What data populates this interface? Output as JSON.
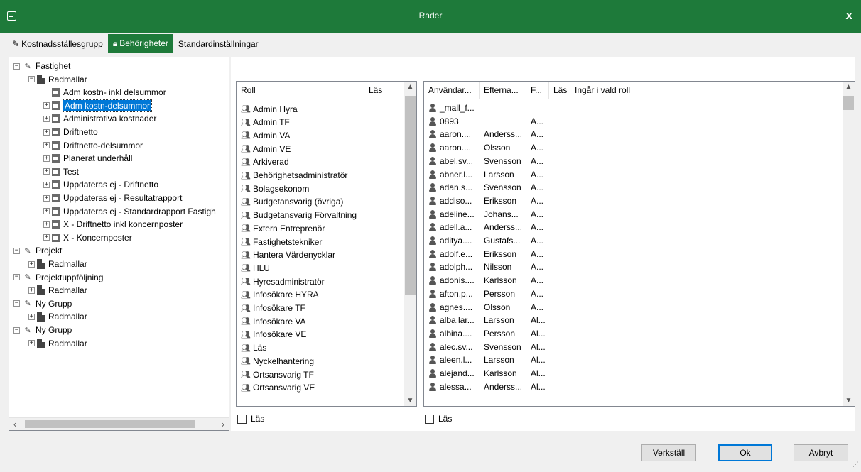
{
  "window": {
    "title": "Rader",
    "close_glyph": "x"
  },
  "tabs": [
    {
      "label": "Kostnadsställesgrupp",
      "icon": "pen-icon"
    },
    {
      "label": "Behörigheter",
      "icon": "lock-icon"
    },
    {
      "label": "Standardinställningar",
      "icon": ""
    }
  ],
  "tree": {
    "items": [
      {
        "label": "Fastighet",
        "level": 0,
        "expander": "-",
        "icon": "pen"
      },
      {
        "label": "Radmallar",
        "level": 1,
        "expander": "-",
        "icon": "folder"
      },
      {
        "label": "Adm kostn- inkl delsummor",
        "level": 2,
        "expander": "",
        "icon": "doc"
      },
      {
        "label": "Adm kostn-delsummor",
        "level": 2,
        "expander": "+",
        "icon": "doc",
        "selected": true
      },
      {
        "label": "Administrativa kostnader",
        "level": 2,
        "expander": "+",
        "icon": "doc"
      },
      {
        "label": "Driftnetto",
        "level": 2,
        "expander": "+",
        "icon": "doc"
      },
      {
        "label": "Driftnetto-delsummor",
        "level": 2,
        "expander": "+",
        "icon": "doc"
      },
      {
        "label": "Planerat underhåll",
        "level": 2,
        "expander": "+",
        "icon": "doc"
      },
      {
        "label": "Test",
        "level": 2,
        "expander": "+",
        "icon": "doc"
      },
      {
        "label": "Uppdateras ej - Driftnetto",
        "level": 2,
        "expander": "+",
        "icon": "doc"
      },
      {
        "label": "Uppdateras ej - Resultatrapport",
        "level": 2,
        "expander": "+",
        "icon": "doc"
      },
      {
        "label": "Uppdateras ej - Standardrapport Fastigh",
        "level": 2,
        "expander": "+",
        "icon": "doc"
      },
      {
        "label": "X - Driftnetto inkl koncernposter",
        "level": 2,
        "expander": "+",
        "icon": "doc"
      },
      {
        "label": "X - Koncernposter",
        "level": 2,
        "expander": "+",
        "icon": "doc"
      },
      {
        "label": "Projekt",
        "level": 0,
        "expander": "-",
        "icon": "pen"
      },
      {
        "label": "Radmallar",
        "level": 1,
        "expander": "+",
        "icon": "folder"
      },
      {
        "label": "Projektuppföljning",
        "level": 0,
        "expander": "-",
        "icon": "pen"
      },
      {
        "label": "Radmallar",
        "level": 1,
        "expander": "+",
        "icon": "folder"
      },
      {
        "label": "Ny Grupp",
        "level": 0,
        "expander": "-",
        "icon": "pen"
      },
      {
        "label": "Radmallar",
        "level": 1,
        "expander": "+",
        "icon": "folder"
      },
      {
        "label": "Ny Grupp",
        "level": 0,
        "expander": "-",
        "icon": "pen"
      },
      {
        "label": "Radmallar",
        "level": 1,
        "expander": "+",
        "icon": "folder"
      }
    ]
  },
  "roles": {
    "columns": [
      "Roll",
      "Läs"
    ],
    "rows": [
      "Admin Hyra",
      "Admin TF",
      "Admin VA",
      "Admin VE",
      "Arkiverad",
      "Behörighetsadministratör",
      "Bolagsekonom",
      "Budgetansvarig (övriga)",
      "Budgetansvarig Förvaltning",
      "Extern Entreprenör",
      "Fastighetstekniker",
      "Hantera Värdenycklar",
      "HLU",
      "Hyresadministratör",
      "Infosökare HYRA",
      "Infosökare TF",
      "Infosökare VA",
      "Infosökare VE",
      "Läs",
      "Nyckelhantering",
      "Ortsansvarig TF",
      "Ortsansvarig VE"
    ],
    "checkbox_label": "Läs"
  },
  "users": {
    "columns": [
      "Användar...",
      "Efterna...",
      "F...",
      "Läs",
      "Ingår i vald roll"
    ],
    "rows": [
      [
        "_mall_f...",
        "",
        ""
      ],
      [
        "0893",
        "",
        "A..."
      ],
      [
        "aaron....",
        "Anderss...",
        "A..."
      ],
      [
        "aaron....",
        "Olsson",
        "A..."
      ],
      [
        "abel.sv...",
        "Svensson",
        "A..."
      ],
      [
        "abner.l...",
        "Larsson",
        "A..."
      ],
      [
        "adan.s...",
        "Svensson",
        "A..."
      ],
      [
        "addiso...",
        "Eriksson",
        "A..."
      ],
      [
        "adeline...",
        "Johans...",
        "A..."
      ],
      [
        "adell.a...",
        "Anderss...",
        "A..."
      ],
      [
        "aditya....",
        "Gustafs...",
        "A..."
      ],
      [
        "adolf.e...",
        "Eriksson",
        "A..."
      ],
      [
        "adolph...",
        "Nilsson",
        "A..."
      ],
      [
        "adonis....",
        "Karlsson",
        "A..."
      ],
      [
        "afton.p...",
        "Persson",
        "A..."
      ],
      [
        "agnes....",
        "Olsson",
        "A..."
      ],
      [
        "alba.lar...",
        "Larsson",
        "Al..."
      ],
      [
        "albina....",
        "Persson",
        "Al..."
      ],
      [
        "alec.sv...",
        "Svensson",
        "Al..."
      ],
      [
        "aleen.l...",
        "Larsson",
        "Al..."
      ],
      [
        "alejand...",
        "Karlsson",
        "Al..."
      ],
      [
        "alessa...",
        "Anderss...",
        "Al..."
      ]
    ],
    "checkbox_label": "Läs"
  },
  "buttons": {
    "apply": "Verkställ",
    "ok": "Ok",
    "cancel": "Avbryt"
  },
  "colors": {
    "titlebar": "#1e7a3a",
    "selection": "#0078d7"
  }
}
